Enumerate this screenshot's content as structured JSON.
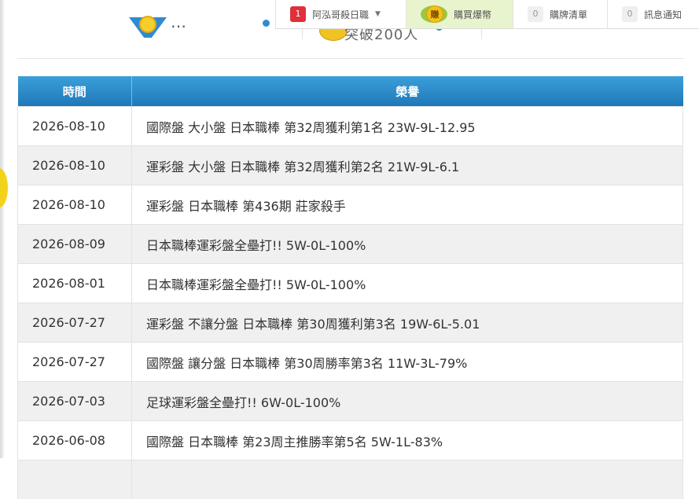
{
  "topbar": {
    "user": {
      "badge": "1",
      "label": "阿泓哥殺日職"
    },
    "coin": {
      "icon_char": "賺",
      "label": "購買爆幣"
    },
    "list": {
      "badge": "0",
      "label": "購牌清單"
    },
    "messages": {
      "badge": "0",
      "label": "訊息通知"
    }
  },
  "stats": {
    "item1_text": "…",
    "item2_text": "突破200人"
  },
  "table": {
    "headers": [
      "時間",
      "榮譽"
    ],
    "rows": [
      {
        "date": "2026-08-10",
        "honor": "國際盤 大小盤 日本職棒 第32周獲利第1名 23W-9L-12.95"
      },
      {
        "date": "2026-08-10",
        "honor": "運彩盤 大小盤 日本職棒 第32周獲利第2名 21W-9L-6.1"
      },
      {
        "date": "2026-08-10",
        "honor": "運彩盤 日本職棒 第436期 莊家殺手"
      },
      {
        "date": "2026-08-09",
        "honor": "日本職棒運彩盤全壘打!! 5W-0L-100%"
      },
      {
        "date": "2026-08-01",
        "honor": "日本職棒運彩盤全壘打!! 5W-0L-100%"
      },
      {
        "date": "2026-07-27",
        "honor": "運彩盤 不讓分盤 日本職棒 第30周獲利第3名 19W-6L-5.01"
      },
      {
        "date": "2026-07-27",
        "honor": "國際盤 讓分盤 日本職棒 第30周勝率第3名 11W-3L-79%"
      },
      {
        "date": "2026-07-03",
        "honor": "足球運彩盤全壘打!! 6W-0L-100%"
      },
      {
        "date": "2026-06-08",
        "honor": "國際盤 日本職棒 第23周主推勝率第5名 5W-1L-83%"
      },
      {
        "date": "",
        "honor": ""
      }
    ]
  },
  "colors": {
    "header_top": "#3b9fd9",
    "header_bottom": "#1f78b8",
    "row_alt": "#f0f0f0",
    "coin_bg": "#e8f4cd",
    "badge_red": "#e0303a"
  }
}
